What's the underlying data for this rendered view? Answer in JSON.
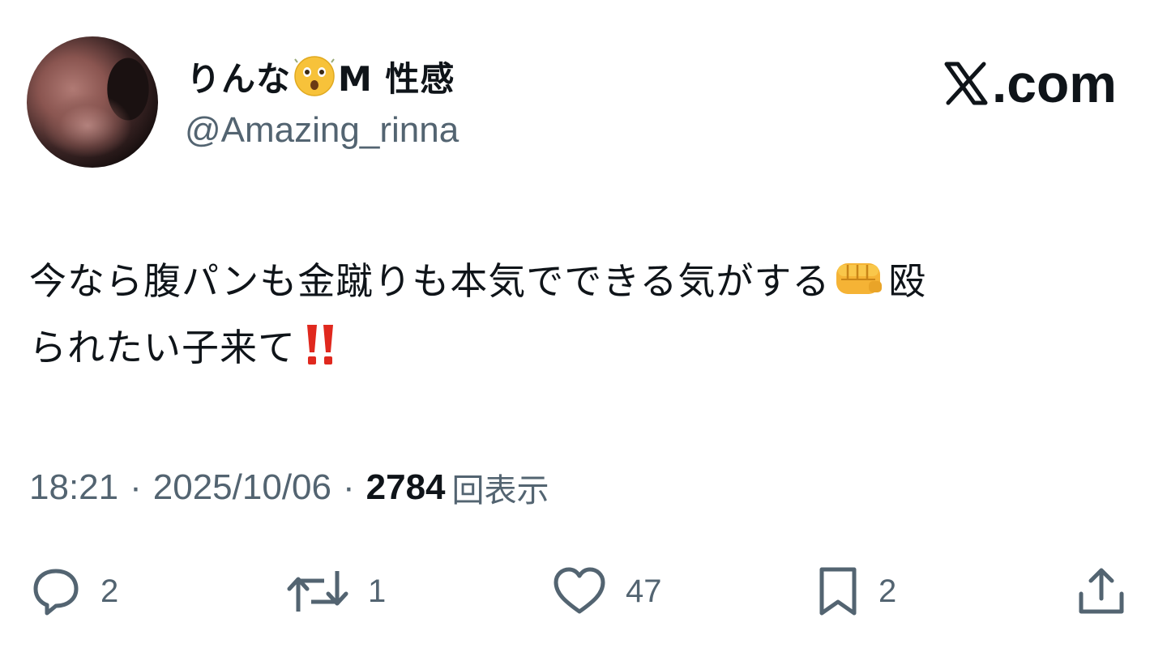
{
  "tweet": {
    "display_name": "りんな",
    "display_name_suffix": "M 性感",
    "handle": "@Amazing_rinna",
    "brand": ".com",
    "text_line1": "今なら腹パンも金蹴りも本気でできる気がする",
    "text_line1_end": "殴",
    "text_line2": "られたい子来て",
    "time": "18:21",
    "separator": "·",
    "date": "2025/10/06",
    "views_count": "2784",
    "views_label": "回表示"
  },
  "actions": {
    "replies": "2",
    "reposts": "1",
    "likes": "47",
    "bookmarks": "2"
  },
  "icons": {
    "name_emoji": "astonished-face-icon",
    "inline_emoji_1": "oncoming-fist-icon",
    "inline_emoji_2": "double-exclamation-icon",
    "brand": "x-logo-icon"
  },
  "colors": {
    "text": "#0f1419",
    "secondary": "#536471",
    "exclamation": "#e0281e",
    "emoji_yellow": "#f7c23a"
  }
}
